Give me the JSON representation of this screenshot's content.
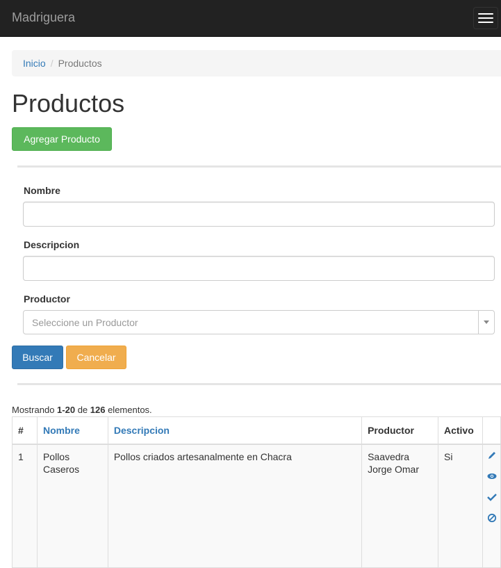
{
  "navbar": {
    "brand": "Madriguera"
  },
  "breadcrumb": {
    "home": "Inicio",
    "separator": "/",
    "current": "Productos"
  },
  "page_title": "Productos",
  "add_button": "Agregar Producto",
  "filters": {
    "nombre_label": "Nombre",
    "nombre_value": "",
    "descripcion_label": "Descripcion",
    "descripcion_value": "",
    "productor_label": "Productor",
    "productor_placeholder": "Seleccione un Productor"
  },
  "buttons": {
    "search": "Buscar",
    "cancel": "Cancelar"
  },
  "summary": {
    "prefix": "Mostrando ",
    "range": "1-20",
    "middle": " de ",
    "total": "126",
    "suffix": " elementos."
  },
  "table": {
    "headers": [
      "#",
      "Nombre",
      "Descripcion",
      "Productor",
      "Activo"
    ],
    "rows": [
      {
        "num": "1",
        "nombre": "Pollos Caseros",
        "descripcion": "Pollos criados artesanalmente en Chacra",
        "productor": "Saavedra Jorge Omar",
        "activo": "Si"
      }
    ]
  },
  "icons": {
    "edit": "pencil-icon",
    "view": "eye-icon",
    "activate": "check-icon",
    "deactivate": "ban-icon"
  },
  "colors": {
    "navbar": "#222222",
    "success": "#5cb85c",
    "primary": "#337ab7",
    "warning": "#f0ad4e",
    "link": "#337ab7"
  }
}
